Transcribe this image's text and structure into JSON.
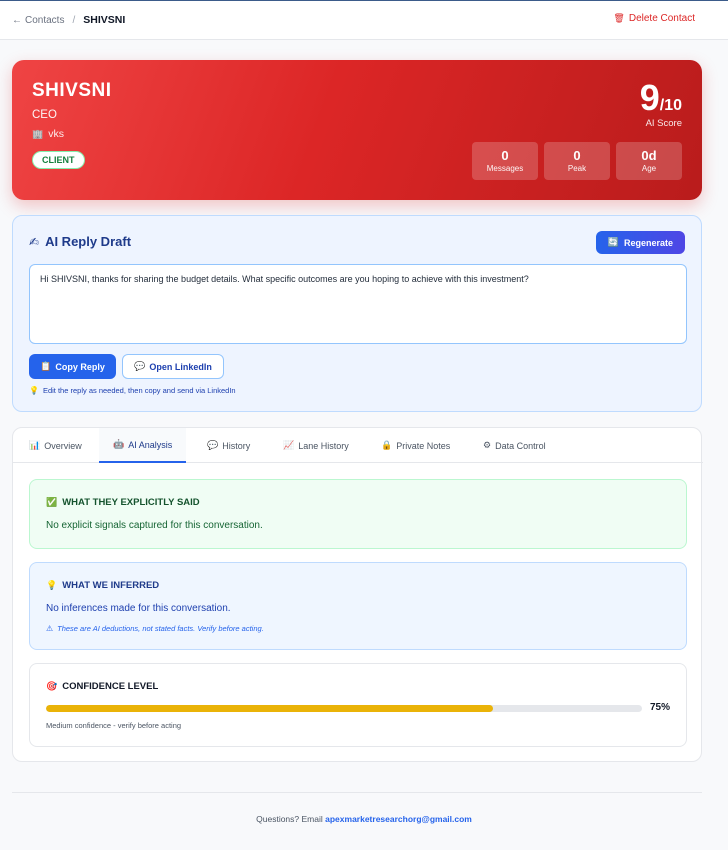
{
  "breadcrumb": {
    "parent": "Contacts",
    "current": "SHIVSNI"
  },
  "delete_label": "Delete Contact",
  "contact": {
    "name": "SHIVSNI",
    "title": "CEO",
    "company": "vks",
    "badge": "CLIENT",
    "score": "9",
    "score_max": "/10",
    "score_label": "AI Score",
    "stats": [
      {
        "value": "0",
        "label": "Messages"
      },
      {
        "value": "0",
        "label": "Peak"
      },
      {
        "value": "0d",
        "label": "Age"
      }
    ]
  },
  "draft": {
    "heading": "AI Reply Draft",
    "regenerate_label": "Regenerate",
    "text": "Hi SHIVSNI, thanks for sharing the budget details. What specific outcomes are you hoping to achieve with this investment?",
    "copy_label": "Copy Reply",
    "linkedin_label": "Open LinkedIn",
    "hint": "Edit the reply as needed, then copy and send via LinkedIn"
  },
  "tabs": [
    {
      "label": "Overview",
      "icon": "bar-chart-icon"
    },
    {
      "label": "AI Analysis",
      "icon": "robot-icon"
    },
    {
      "label": "History",
      "icon": "speech-bubble-icon"
    },
    {
      "label": "Lane History",
      "icon": "trend-chart-icon"
    },
    {
      "label": "Private Notes",
      "icon": "lock-icon"
    },
    {
      "label": "Data Control",
      "icon": "gear-icon"
    }
  ],
  "active_tab": "AI Analysis",
  "analysis": {
    "said_heading": "WHAT THEY EXPLICITLY SAID",
    "said_body": "No explicit signals captured for this conversation.",
    "inferred_heading": "WHAT WE INFERRED",
    "inferred_body": "No inferences made for this conversation.",
    "inferred_note": "These are AI deductions, not stated facts. Verify before acting.",
    "confidence_heading": "CONFIDENCE LEVEL",
    "confidence_value": 0.75,
    "confidence_text": "75%",
    "confidence_note": "Medium confidence - verify before acting"
  },
  "footer": {
    "text": "Questions? Email",
    "email": "apexmarketresearchorg@gmail.com"
  },
  "colors": {
    "hero": "#dc2626",
    "primary": "#2563eb",
    "confidence": "#eab308"
  }
}
